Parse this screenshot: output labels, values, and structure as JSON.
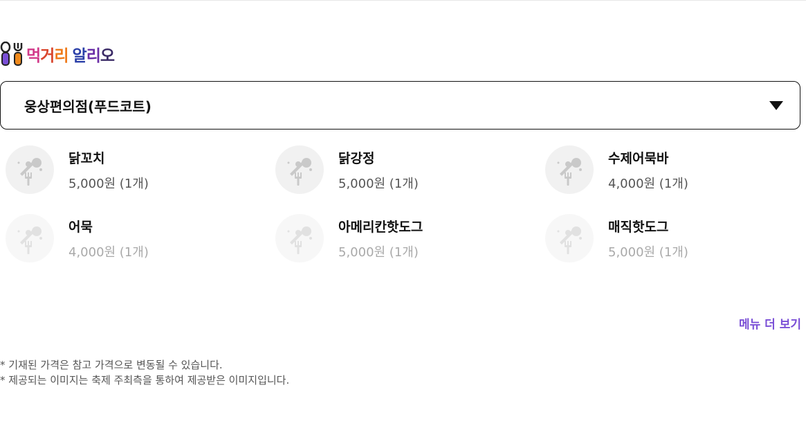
{
  "logo": {
    "chars": [
      "먹",
      "거",
      "리",
      "알",
      "리",
      "오"
    ],
    "colors": [
      "#d23a8a",
      "#d9452c",
      "#ef7a1a",
      "#2a3fa8",
      "#6a2ea6",
      "#3a2a66"
    ]
  },
  "store_select": {
    "selected": "웅상편의점(푸드코트)"
  },
  "menu": [
    {
      "name": "닭꼬치",
      "price": "5,000원 (1개)"
    },
    {
      "name": "닭강정",
      "price": "5,000원 (1개)"
    },
    {
      "name": "수제어묵바",
      "price": "4,000원 (1개)"
    },
    {
      "name": "어묵",
      "price": "4,000원 (1개)"
    },
    {
      "name": "아메리칸핫도그",
      "price": "5,000원 (1개)"
    },
    {
      "name": "매직핫도그",
      "price": "5,000원 (1개)"
    }
  ],
  "more_link": "메뉴 더 보기",
  "notes": [
    "* 기재된 가격은 참고 가격으로 변동될 수 있습니다.",
    "* 제공되는 이미지는 축제 주최측을 통하여 제공받은 이미지입니다."
  ],
  "colors": {
    "accent": "#7a4fd6",
    "thumb_bg": "#f1f1f1"
  }
}
